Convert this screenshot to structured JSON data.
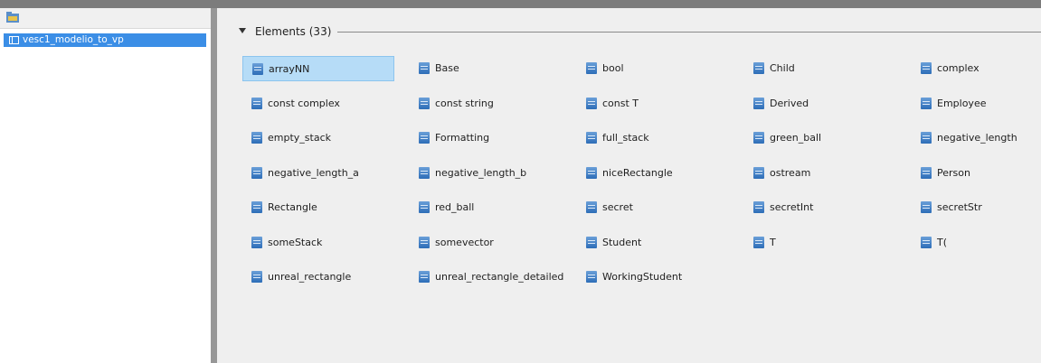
{
  "tree": {
    "toolbar_icon": "model-browser-icon",
    "items": [
      {
        "label": "vesc1_modelio_to_vp",
        "icon": "package-icon",
        "selected": true
      }
    ]
  },
  "section": {
    "title": "Elements (33)",
    "expanded": true
  },
  "elements": [
    "arrayNN",
    "Base",
    "bool",
    "Child",
    "complex",
    "const complex",
    "const string",
    "const T",
    "Derived",
    "Employee",
    "empty_stack",
    "Formatting",
    "full_stack",
    "green_ball",
    "negative_length",
    "negative_length_a",
    "negative_length_b",
    "niceRectangle",
    "ostream",
    "Person",
    "Rectangle",
    "red_ball",
    "secret",
    "secretInt",
    "secretStr",
    "someStack",
    "somevector",
    "Student",
    "T",
    "T(",
    "unreal_rectangle",
    "unreal_rectangle_detailed",
    "WorkingStudent"
  ],
  "selected_element": "arrayNN",
  "colors": {
    "selection": "#3b8ee6",
    "item_selected": "#b6dcf7",
    "icon": "#3a78c0"
  }
}
